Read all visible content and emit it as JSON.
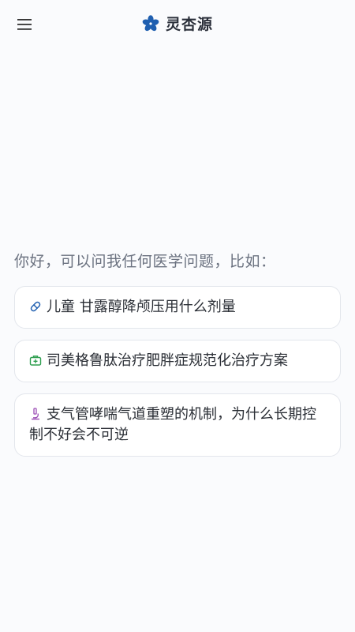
{
  "header": {
    "title": "灵杏源",
    "menu_icon": "hamburger-menu-icon",
    "logo_icon": "flower-logo-icon",
    "brand_color": "#1f5fb0"
  },
  "main": {
    "greeting": "你好，可以问我任何医学问题，比如："
  },
  "suggestions": [
    {
      "text": "儿童 甘露醇降颅压用什么剂量",
      "icon": "pill-icon",
      "icon_color": "#1f5fb0"
    },
    {
      "text": "司美格鲁肽治疗肥胖症规范化治疗方案",
      "icon": "medical-kit-icon",
      "icon_color": "#2e9e4f"
    },
    {
      "text": "支气管哮喘气道重塑的机制，为什么长期控制不好会不可逆",
      "icon": "microscope-icon",
      "icon_color": "#9b4db5"
    }
  ]
}
